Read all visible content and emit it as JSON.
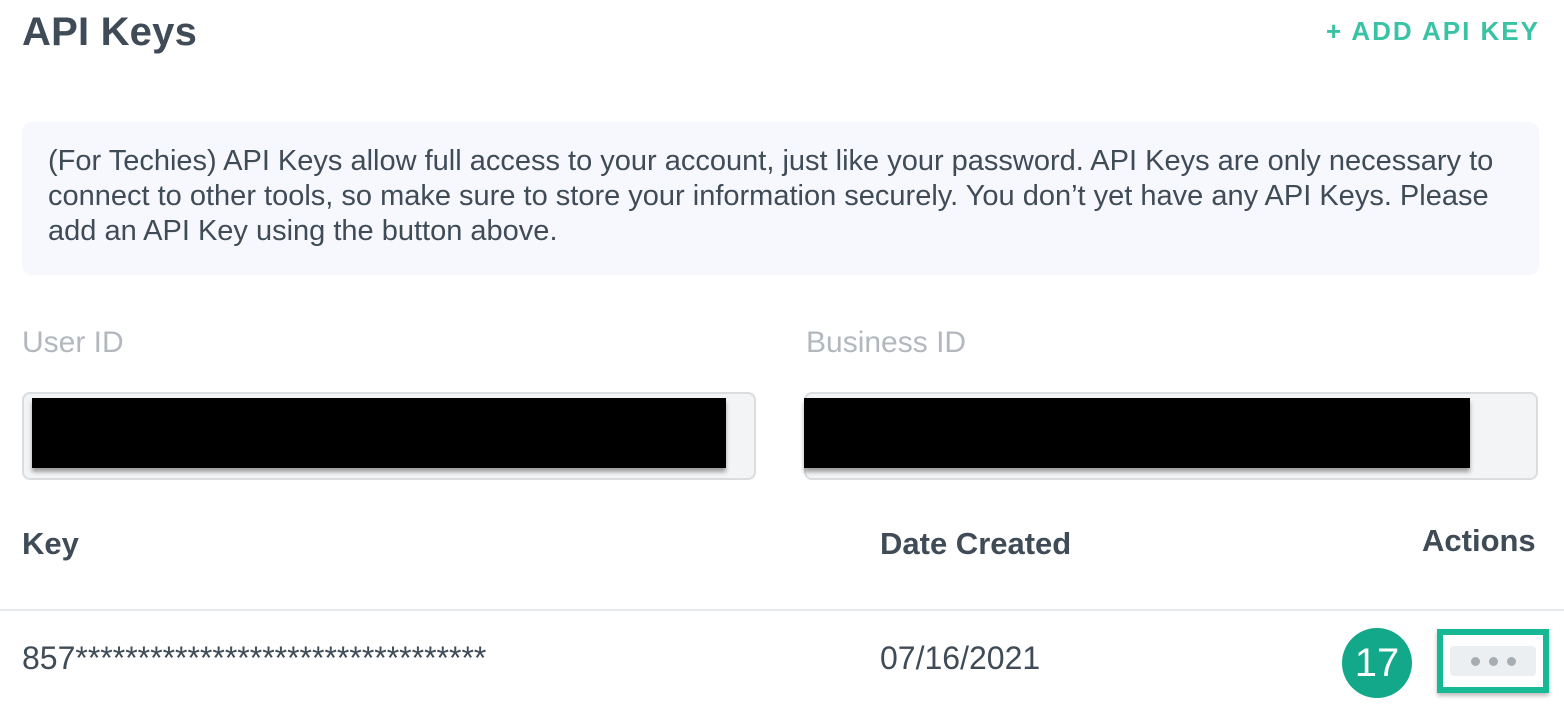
{
  "header": {
    "title": "API Keys",
    "add_button_label": "+ ADD API KEY"
  },
  "info": {
    "text": "(For Techies) API Keys allow full access to your account, just like your password. API Keys are only necessary to connect to other tools, so make sure to store your information securely. You don’t yet have any API Keys. Please add an API Key using the button above."
  },
  "fields": {
    "user_id_label": "User ID",
    "business_id_label": "Business ID"
  },
  "table": {
    "headers": {
      "key": "Key",
      "date_created": "Date Created",
      "actions": "Actions"
    },
    "rows": [
      {
        "key": "857*********************************",
        "date_created": "07/16/2021"
      }
    ]
  },
  "annotation": {
    "badge_number": "17"
  },
  "icons": {
    "actions": "more-horizontal-icon"
  },
  "colors": {
    "accent": "#38c3a5",
    "badge": "#14a88a",
    "highlight": "#17b894"
  }
}
